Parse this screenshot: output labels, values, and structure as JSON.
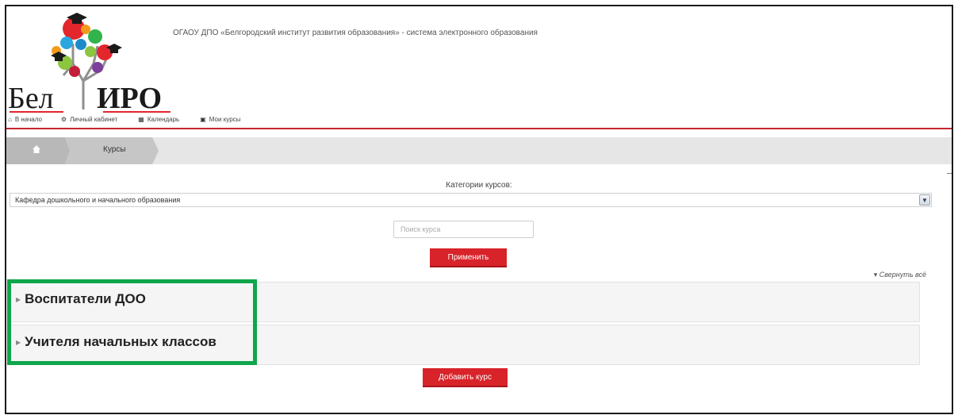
{
  "header": {
    "logo_text": "Бел ИРО",
    "site_title": "ОГАОУ ДПО «Белгородский институт развития образования» - система электронного образования"
  },
  "nav": [
    {
      "label": "В начало",
      "icon": "home-icon"
    },
    {
      "label": "Личный кабинет",
      "icon": "dashboard-icon"
    },
    {
      "label": "Календарь",
      "icon": "calendar-icon"
    },
    {
      "label": "Мои курсы",
      "icon": "briefcase-icon"
    }
  ],
  "breadcrumb": {
    "current": "Курсы"
  },
  "category": {
    "label": "Категории курсов:",
    "selected": "Кафедра дошкольного и начального образования"
  },
  "search": {
    "placeholder": "Поиск курса",
    "value": ""
  },
  "buttons": {
    "apply": "Применить",
    "add_course": "Добавить курс"
  },
  "collapse_all": "Свернуть всё",
  "subcategories": [
    {
      "name": "Воспитатели ДОО"
    },
    {
      "name": "Учителя начальных классов"
    }
  ],
  "colors": {
    "accent": "#d8232a",
    "highlight": "#0ea64b"
  }
}
